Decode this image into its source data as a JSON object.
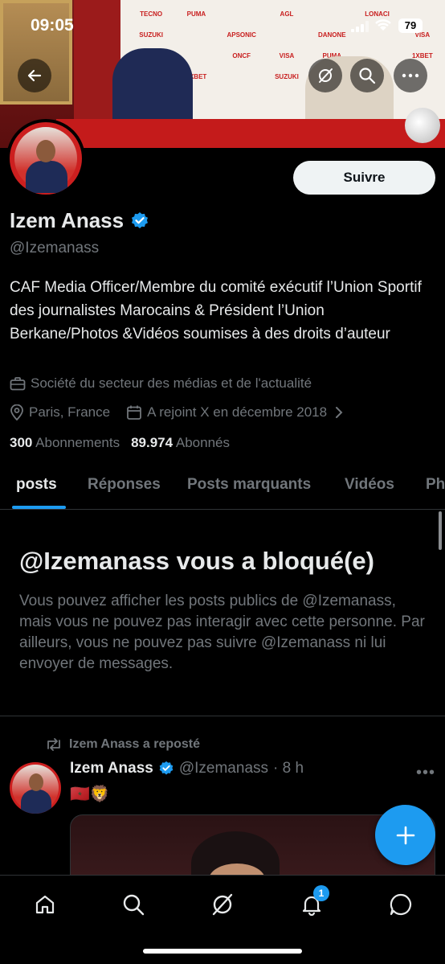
{
  "status_bar": {
    "time": "09:05",
    "battery": "79"
  },
  "banner": {
    "logos": [
      "TECNO",
      "PUMA",
      "",
      "AGL",
      "",
      "LONACI",
      "",
      "SUZUKI",
      "",
      "APSONIC",
      "",
      "DANONE",
      "",
      "VISA",
      "DANONE",
      "",
      "ONCF",
      "VISA",
      "PUMA",
      "",
      "1XBET",
      "TECNO",
      "1XBET",
      "",
      "SUZUKI",
      "",
      "",
      ""
    ]
  },
  "profile": {
    "name": "Izem Anass",
    "handle": "@Izemanass",
    "follow_label": "Suivre",
    "bio": "CAF Media Officer/Membre du comité exécutif l’Union Sportif des journalistes Marocains & Président l’Union Berkane/Photos &Vidéos soumises à des droits d’auteur",
    "category": "Société du secteur des médias et de l'actualité",
    "location": "Paris, France",
    "joined": "A rejoint X en décembre 2018",
    "following_count": "300",
    "following_label": "Abonnements",
    "followers_count": "89.974",
    "followers_label": "Abonnés"
  },
  "tabs": [
    {
      "label": "posts"
    },
    {
      "label": "Réponses"
    },
    {
      "label": "Posts marquants"
    },
    {
      "label": "Vidéos"
    },
    {
      "label": "Ph"
    }
  ],
  "blocked": {
    "title": "@Izemanass vous a bloqué(e)",
    "text": "Vous pouvez afficher les posts publics de @Izemanass, mais vous ne pouvez pas interagir avec cette personne. Par ailleurs, vous ne pouvez pas suivre @Izemanass ni lui envoyer de messages."
  },
  "post": {
    "repost_label": "Izem Anass a reposté",
    "author_name": "Izem Anass",
    "author_handle": "@Izemanass",
    "time": "· 8 h",
    "text": "🇲🇦🦁"
  },
  "bottom_nav": {
    "items": [
      "home-icon",
      "search-icon",
      "grok-icon",
      "notifications-icon",
      "messages-icon"
    ],
    "notification_count": "1"
  },
  "colors": {
    "accent": "#1d9bf0",
    "background": "#000000",
    "muted": "#71767b"
  }
}
